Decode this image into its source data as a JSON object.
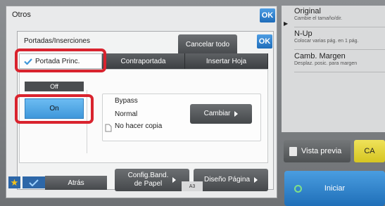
{
  "dialog": {
    "title": "Otros",
    "ok_label": "OK"
  },
  "inner": {
    "title": "Portadas/Inserciones",
    "cancel_all": "Cancelar todo",
    "ok_label": "OK",
    "tabs": [
      {
        "label": "Portada Princ."
      },
      {
        "label": "Contraportada"
      },
      {
        "label": "Insertar Hoja"
      }
    ],
    "off_label": "Off",
    "on_label": "On",
    "paper": {
      "bypass": "Bypass",
      "type": "Normal",
      "no_copy": "No hacer copia",
      "change": "Cambiar"
    },
    "config_band": "Config.Band.\nde Papel",
    "diseno_pagina": "Diseño Página"
  },
  "right_list": {
    "items": [
      {
        "title": "Original",
        "subtitle": "Cambie el tamaño/dir."
      },
      {
        "title": "N-Up",
        "subtitle": "Colocar varias pág. en 1 pág."
      },
      {
        "title": "Camb. Margen",
        "subtitle": "Desplaz. posic. para margen"
      }
    ]
  },
  "actions": {
    "vista_previa": "Vista previa",
    "ca": "CA",
    "iniciar": "Iniciar"
  },
  "bottom": {
    "atras": "Atrás",
    "paper_size": "A3"
  },
  "colors": {
    "accent_blue": "#3f97da",
    "highlight_red": "#d9232e",
    "ca_yellow": "#d6c521"
  }
}
